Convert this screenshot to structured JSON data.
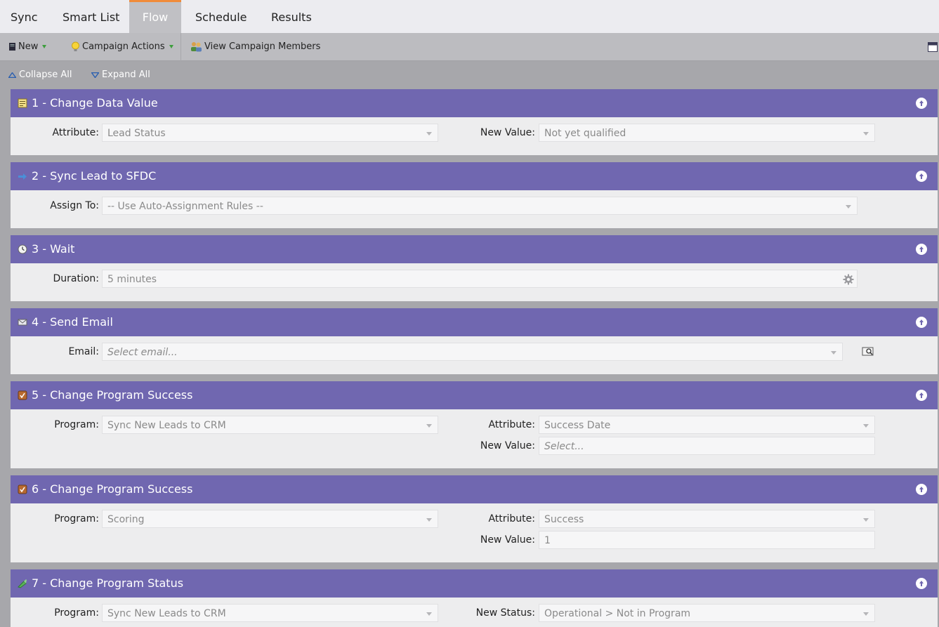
{
  "tabs": [
    {
      "label": "Sync",
      "active": false
    },
    {
      "label": "Smart List",
      "active": false
    },
    {
      "label": "Flow",
      "active": true
    },
    {
      "label": "Schedule",
      "active": false
    },
    {
      "label": "Results",
      "active": false
    }
  ],
  "toolbar": {
    "new_label": "New",
    "campaign_actions_label": "Campaign Actions",
    "view_members_label": "View Campaign Members"
  },
  "controls": {
    "collapse_all": "Collapse All",
    "expand_all": "Expand All"
  },
  "steps": [
    {
      "title": "1 - Change Data Value",
      "icon": "note-icon",
      "fields": [
        {
          "label": "Attribute:",
          "value": "Lead Status"
        },
        {
          "label": "New Value:",
          "value": "Not yet qualified"
        }
      ]
    },
    {
      "title": "2 - Sync Lead to SFDC",
      "icon": "sync-arrow-icon",
      "fields": [
        {
          "label": "Assign To:",
          "value": "-- Use Auto-Assignment Rules --"
        }
      ]
    },
    {
      "title": "3 - Wait",
      "icon": "clock-icon",
      "fields": [
        {
          "label": "Duration:",
          "value": "5 minutes"
        }
      ]
    },
    {
      "title": "4 - Send Email",
      "icon": "email-icon",
      "fields": [
        {
          "label": "Email:",
          "placeholder": "Select email..."
        }
      ]
    },
    {
      "title": "5 - Change Program Success",
      "icon": "program-icon",
      "fields": [
        {
          "label": "Program:",
          "value": "Sync New Leads to CRM"
        },
        {
          "label": "Attribute:",
          "value": "Success Date"
        },
        {
          "label": "New Value:",
          "placeholder": "Select..."
        }
      ]
    },
    {
      "title": "6 - Change Program Success",
      "icon": "program-icon",
      "fields": [
        {
          "label": "Program:",
          "value": "Scoring"
        },
        {
          "label": "Attribute:",
          "value": "Success"
        },
        {
          "label": "New Value:",
          "value": "1"
        }
      ]
    },
    {
      "title": "7 - Change Program Status",
      "icon": "status-icon",
      "fields": [
        {
          "label": "Program:",
          "value": "Sync New Leads to CRM"
        },
        {
          "label": "New Status:",
          "value": "Operational > Not in Program"
        }
      ]
    }
  ],
  "colors": {
    "step_header": "#7067b0",
    "active_tab_accent": "#f08b3a",
    "dropdown_caret": "#3c9e3c"
  }
}
